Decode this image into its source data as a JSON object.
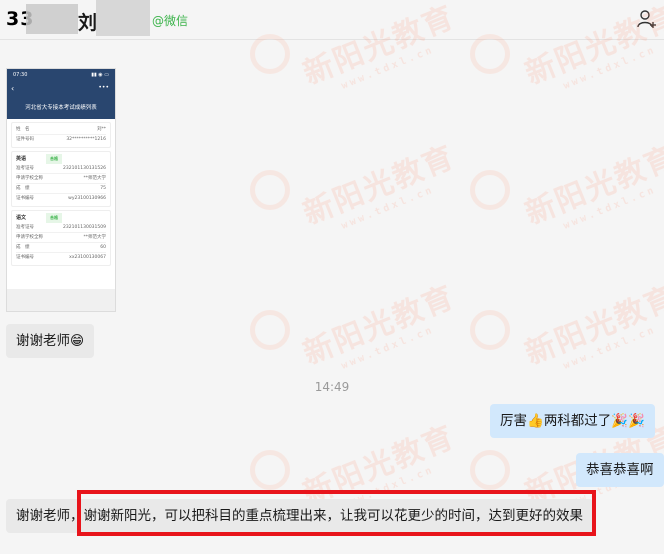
{
  "header": {
    "name_lead": "33",
    "name_tail": "刘",
    "source": "@微信",
    "add_user_icon": "add-user-icon"
  },
  "watermark": {
    "brand": "新阳光教育",
    "url": "www.tdxl.cn"
  },
  "phone_screenshot": {
    "status_time": "07:30",
    "status_signal": "▮▮ ◉ ▭",
    "title": "河北省大专接本考试成绩列表",
    "fields": [
      {
        "k": "姓　名",
        "v": "刘**"
      },
      {
        "k": "证件号码",
        "v": "32**********1216"
      }
    ],
    "subjects": [
      {
        "name": "英语",
        "tag": "合格",
        "rows": [
          {
            "k": "准考证号",
            "v": "232101130131526"
          },
          {
            "k": "申请学校全称",
            "v": "**师范大学"
          },
          {
            "k": "成　绩",
            "v": "75"
          },
          {
            "k": "证书编号",
            "v": "wy23100130966"
          }
        ]
      },
      {
        "name": "语文",
        "tag": "合格",
        "rows": [
          {
            "k": "准考证号",
            "v": "232101130031509"
          },
          {
            "k": "申请学校全称",
            "v": "**师范大学"
          },
          {
            "k": "成　绩",
            "v": "60"
          },
          {
            "k": "证书编号",
            "v": "xx23100130067"
          }
        ]
      }
    ]
  },
  "messages": [
    {
      "side": "left",
      "text": "谢谢老师",
      "emoji": "😁"
    },
    {
      "side": "time",
      "text": "14:49"
    },
    {
      "side": "right",
      "text_a": "厉害",
      "emoji_a": "👍",
      "text_b": "两科都过了",
      "emoji_b": "🎉🎉"
    },
    {
      "side": "right",
      "text": "恭喜恭喜啊"
    },
    {
      "side": "left",
      "text": "谢谢老师，谢谢新阳光，可以把科目的重点梳理出来，让我可以花更少的时间，达到更好的效果"
    }
  ],
  "colors": {
    "bubble_left": "#e9e9e9",
    "bubble_right": "#d2e8fc",
    "highlight": "#e8141b",
    "source_green": "#3bb34a"
  }
}
